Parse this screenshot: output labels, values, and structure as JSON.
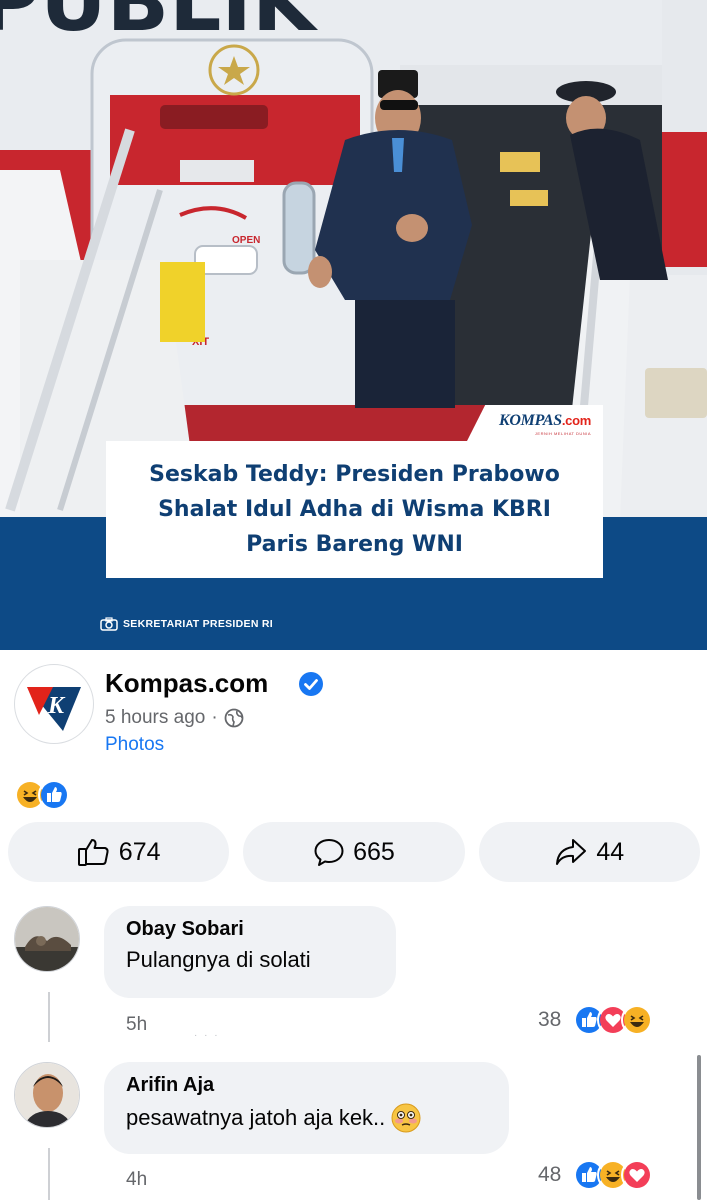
{
  "post_image": {
    "headline": "Seskab Teddy: Presiden Prabowo Shalat Idul Adha di Wisma KBRI Paris Bareng WNI",
    "watermark_brand": "KOMPAS",
    "watermark_domain": ".com",
    "watermark_tagline": "JERNIH MELIHAT DUNIA",
    "photo_credit": "SEKRETARIAT PRESIDEN RI",
    "aircraft_letters": "PUBLIK",
    "door_label": "OPEN",
    "exit_label": "XIT",
    "icon": "camera-icon"
  },
  "post": {
    "page_name": "Kompas.com",
    "verified_icon": "verified-badge-icon",
    "time": "5 hours ago",
    "separator": "·",
    "audience_icon": "globe-icon",
    "attachment_link": "Photos",
    "reaction_icons": [
      "haha-reaction-icon",
      "like-reaction-icon"
    ]
  },
  "actions": {
    "like_count": "674",
    "comment_count": "665",
    "share_count": "44"
  },
  "comments": [
    {
      "author": "Obay Sobari",
      "text": "Pulangnya di solati",
      "emoji": "",
      "time": "5h",
      "reaction_count": "38",
      "reactions": [
        "like-reaction-icon",
        "love-reaction-icon",
        "haha-reaction-icon"
      ]
    },
    {
      "author": "Arifin Aja",
      "text": "pesawatnya jatoh aja kek..",
      "emoji": "flushed-face-emoji",
      "time": "4h",
      "reaction_count": "48",
      "reactions": [
        "like-reaction-icon",
        "haha-reaction-icon",
        "love-reaction-icon"
      ]
    }
  ],
  "colors": {
    "facebook_blue": "#1877f2",
    "love_red": "#f33e58",
    "haha_yellow": "#f7b125",
    "kompas_navy": "#0f3f73",
    "band_blue": "#0d4a86"
  }
}
